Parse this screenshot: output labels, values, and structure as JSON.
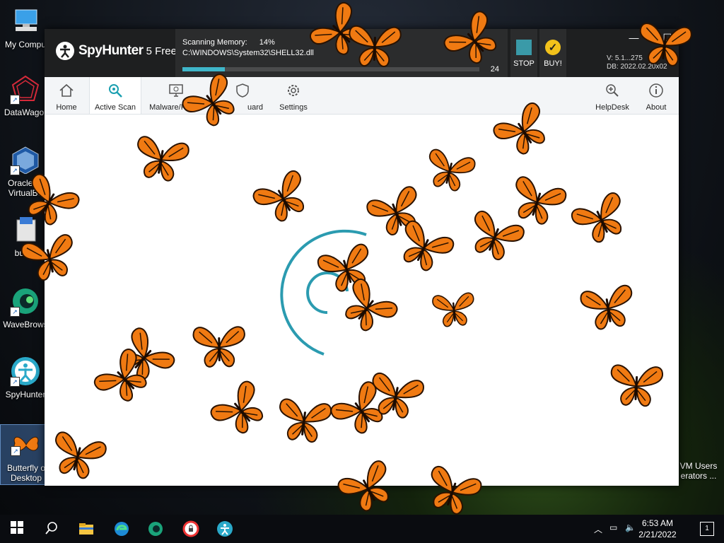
{
  "desktop": {
    "icons": [
      {
        "label": "My Compu",
        "icon": "computer-icon"
      },
      {
        "label": "DataWagor",
        "icon": "datawagon-icon"
      },
      {
        "label": "Oracle VI VirtualBo",
        "icon": "virtualbox-icon"
      },
      {
        "label": "butter",
        "icon": "installer-icon"
      },
      {
        "label": "WaveBrows",
        "icon": "wavebrowser-icon"
      },
      {
        "label": "SpyHunter",
        "icon": "spyhunter-icon"
      },
      {
        "label": "Butterfly o Desktop",
        "icon": "butterfly-icon"
      }
    ],
    "right_icon_label": "VM Users erators ..."
  },
  "app": {
    "logo_name": "SpyHunter",
    "logo_version": "5 Free",
    "scan": {
      "label": "Scanning Memory:",
      "percent": "14%",
      "progress": 0.14,
      "path": "C:\\WINDOWS\\System32\\SHELL32.dll",
      "count": "24"
    },
    "stop_label": "STOP",
    "buy_label": "BUY!",
    "version_line": "V: 5.1...275",
    "db_line": "DB: 2022.02.20x02",
    "toolbar": {
      "home": "Home",
      "active_scan": "Active Scan",
      "malware": "Malware/PC Sc",
      "guard": "uard",
      "settings": "Settings",
      "helpdesk": "HelpDesk",
      "about": "About"
    }
  },
  "taskbar": {
    "time": "6:53 AM",
    "date": "2/21/2022",
    "notifications": "1"
  },
  "colors": {
    "accent": "#3fb6c9",
    "butterfly": "#f07a12",
    "titlebar": "#1e1f20"
  }
}
